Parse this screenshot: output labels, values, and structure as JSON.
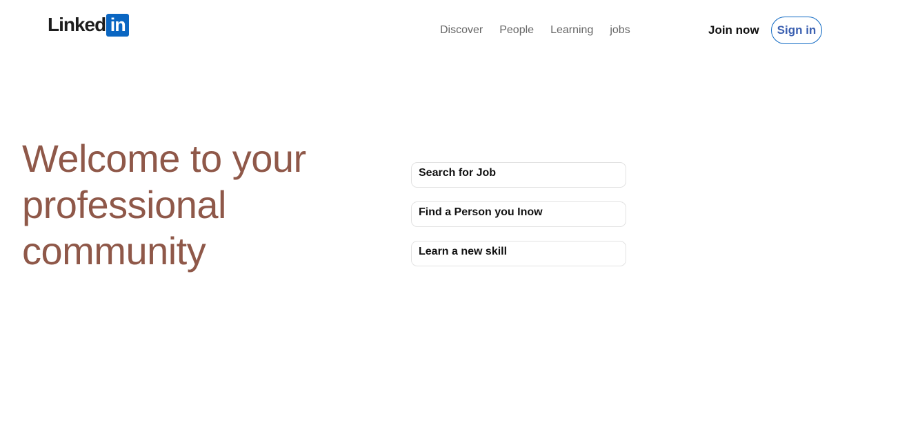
{
  "header": {
    "logo": {
      "word": "Linked",
      "box": "in"
    },
    "nav": [
      {
        "label": "Discover"
      },
      {
        "label": "People"
      },
      {
        "label": "Learning"
      },
      {
        "label": "jobs"
      }
    ],
    "join_label": "Join now",
    "signin_label": "Sign in"
  },
  "hero": {
    "headline": "Welcome to your professional community",
    "options": [
      {
        "label": "Search for Job"
      },
      {
        "label": "Find a Person you Inow"
      },
      {
        "label": "Learn a new skill"
      }
    ]
  },
  "colors": {
    "brand_blue": "#0a66c2",
    "headline": "#8f5849",
    "nav_text": "#666666",
    "signin_text": "#3a5fb0"
  }
}
